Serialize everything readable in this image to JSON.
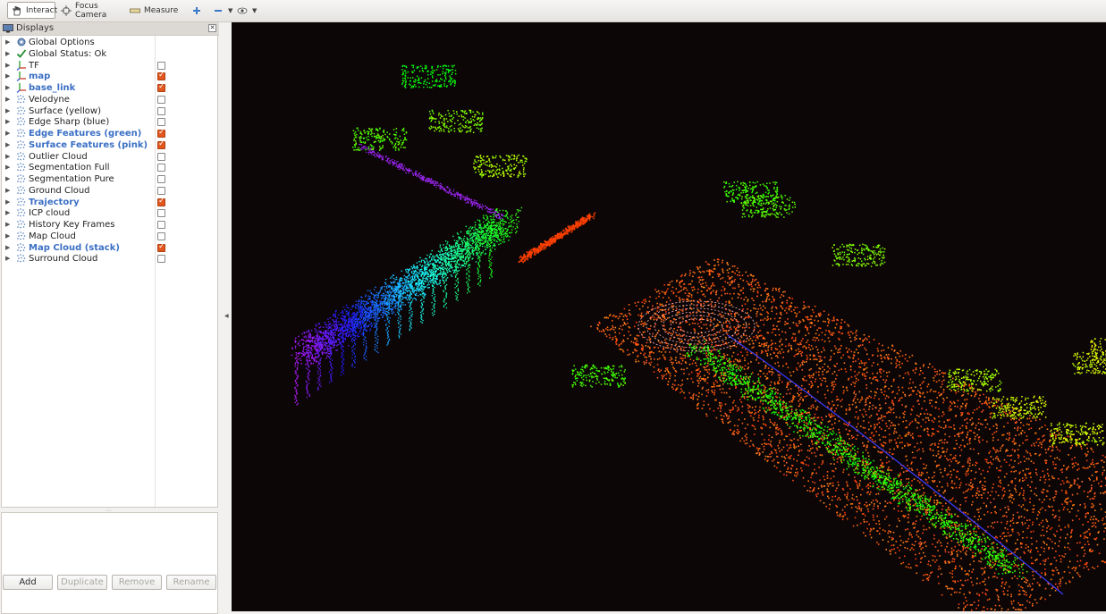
{
  "toolbar": {
    "interact": "Interact",
    "focus_camera": "Focus Camera",
    "measure": "Measure"
  },
  "displays": {
    "title": "Displays",
    "items": [
      {
        "label": "Global Options",
        "icon": "gear-icon",
        "checkbox": false,
        "checked": false
      },
      {
        "label": "Global Status: Ok",
        "icon": "check-icon",
        "checkbox": false,
        "checked": false
      },
      {
        "label": "TF",
        "icon": "axes-icon",
        "checkbox": true,
        "checked": false
      },
      {
        "label": "map",
        "icon": "axes-icon",
        "checkbox": true,
        "checked": true
      },
      {
        "label": "base_link",
        "icon": "axes-icon",
        "checkbox": true,
        "checked": true
      },
      {
        "label": "Velodyne",
        "icon": "pointcloud-icon",
        "checkbox": true,
        "checked": false
      },
      {
        "label": "Surface (yellow)",
        "icon": "pointcloud-icon",
        "checkbox": true,
        "checked": false
      },
      {
        "label": "Edge Sharp (blue)",
        "icon": "pointcloud-icon",
        "checkbox": true,
        "checked": false
      },
      {
        "label": "Edge Features (green)",
        "icon": "pointcloud-icon",
        "checkbox": true,
        "checked": true
      },
      {
        "label": "Surface Features (pink)",
        "icon": "pointcloud-icon",
        "checkbox": true,
        "checked": true
      },
      {
        "label": "Outlier Cloud",
        "icon": "pointcloud-icon",
        "checkbox": true,
        "checked": false
      },
      {
        "label": "Segmentation Full",
        "icon": "pointcloud-icon",
        "checkbox": true,
        "checked": false
      },
      {
        "label": "Segmentation Pure",
        "icon": "pointcloud-icon",
        "checkbox": true,
        "checked": false
      },
      {
        "label": "Ground Cloud",
        "icon": "pointcloud-icon",
        "checkbox": true,
        "checked": false
      },
      {
        "label": "Trajectory",
        "icon": "pointcloud-icon",
        "checkbox": true,
        "checked": true
      },
      {
        "label": "ICP cloud",
        "icon": "pointcloud-icon",
        "checkbox": true,
        "checked": false
      },
      {
        "label": "History Key Frames",
        "icon": "pointcloud-icon",
        "checkbox": true,
        "checked": false
      },
      {
        "label": "Map Cloud",
        "icon": "pointcloud-icon",
        "checkbox": true,
        "checked": false
      },
      {
        "label": "Map Cloud (stack)",
        "icon": "pointcloud-icon",
        "checkbox": true,
        "checked": true
      },
      {
        "label": "Surround Cloud",
        "icon": "pointcloud-icon",
        "checkbox": true,
        "checked": false
      }
    ]
  },
  "buttons": {
    "add": "Add",
    "duplicate": "Duplicate",
    "remove": "Remove",
    "rename": "Rename"
  },
  "colors": {
    "checked": "#e2571e",
    "enabled_label": "#3a6fc4",
    "viewport_bg": "#0c0606"
  }
}
